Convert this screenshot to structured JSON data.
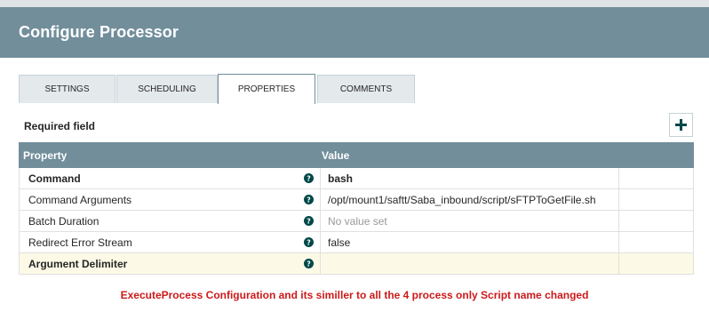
{
  "dialog": {
    "title": "Configure Processor"
  },
  "tabs": [
    {
      "label": "SETTINGS",
      "active": false
    },
    {
      "label": "SCHEDULING",
      "active": false
    },
    {
      "label": "PROPERTIES",
      "active": true
    },
    {
      "label": "COMMENTS",
      "active": false
    }
  ],
  "properties": {
    "required_label": "Required field",
    "add_icon": "plus-icon",
    "columns": {
      "property": "Property",
      "value": "Value"
    },
    "rows": [
      {
        "name": "Command",
        "value": "bash",
        "required": true,
        "placeholder": false
      },
      {
        "name": "Command Arguments",
        "value": "/opt/mount1/saftt/Saba_inbound/script/sFTPToGetFile.sh",
        "required": false,
        "placeholder": false
      },
      {
        "name": "Batch Duration",
        "value": "No value set",
        "required": false,
        "placeholder": true
      },
      {
        "name": "Redirect Error Stream",
        "value": "false",
        "required": false,
        "placeholder": false
      },
      {
        "name": "Argument Delimiter",
        "value": "",
        "required": true,
        "placeholder": false
      }
    ]
  },
  "annotation": "ExecuteProcess Configuration and its similler to all the 4 process only Script name changed",
  "colors": {
    "header_bg": "#728e9b",
    "tab_bg": "#e4e9ec",
    "help_icon": "#004849",
    "add_icon": "#004849",
    "highlight_row": "#fcf9e6",
    "annotation_text": "#cc1a1a"
  }
}
